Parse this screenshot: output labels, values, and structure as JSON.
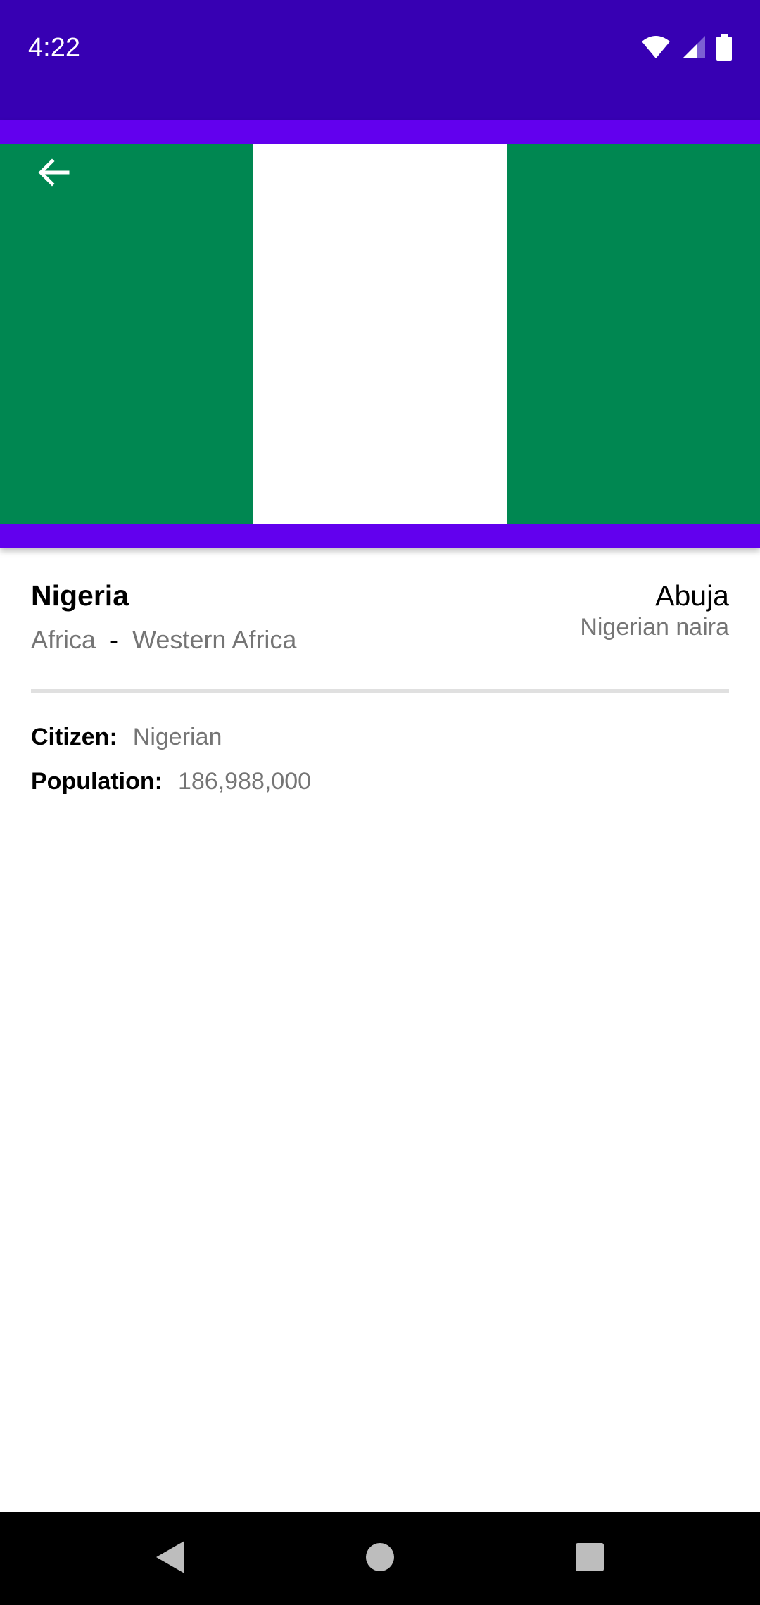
{
  "status_bar": {
    "time": "4:22",
    "icons": [
      "wifi-icon",
      "cell-signal-icon",
      "battery-icon"
    ]
  },
  "app_bar": {
    "back_icon": "arrow-left-icon",
    "flag_colors": [
      "#008751",
      "#ffffff",
      "#008751"
    ]
  },
  "country": {
    "name": "Nigeria",
    "region": "Africa",
    "separator": "-",
    "subregion": "Western Africa",
    "capital": "Abuja",
    "currency": "Nigerian naira"
  },
  "info": {
    "citizen_label": "Citizen:",
    "citizen_value": "Nigerian",
    "population_label": "Population:",
    "population_value": "186,988,000"
  },
  "nav_bar": {
    "icons": [
      "back-triangle-icon",
      "home-circle-icon",
      "recents-square-icon"
    ]
  },
  "colors": {
    "status_bar": "#3700b3",
    "app_bar": "#6200ee",
    "secondary_text": "#757575"
  }
}
